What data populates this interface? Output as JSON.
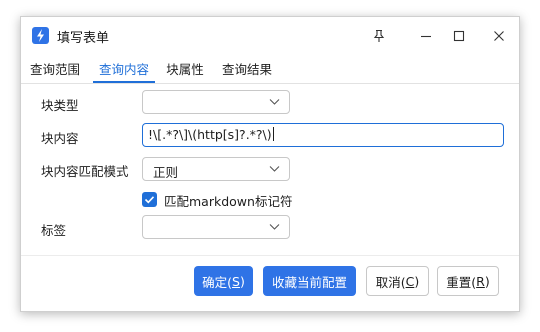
{
  "window": {
    "title": "填写表单"
  },
  "tabs": [
    {
      "label": "查询范围",
      "active": false
    },
    {
      "label": "查询内容",
      "active": true
    },
    {
      "label": "块属性",
      "active": false
    },
    {
      "label": "查询结果",
      "active": false
    }
  ],
  "form": {
    "block_type": {
      "label": "块类型",
      "value": ""
    },
    "block_content": {
      "label": "块内容",
      "value": "!\\[.*?\\]\\(http[s]?.*?\\)"
    },
    "match_mode": {
      "label": "块内容匹配模式",
      "value": "正则"
    },
    "markdown_checkbox": {
      "label": "匹配markdown标记符",
      "checked": true
    },
    "tag": {
      "label": "标签",
      "value": ""
    }
  },
  "buttons": {
    "confirm": {
      "text": "确定(",
      "key": "S",
      "tail": ")"
    },
    "save_config": {
      "text": "收藏当前配置"
    },
    "cancel": {
      "text": "取消(",
      "key": "C",
      "tail": ")"
    },
    "reset": {
      "text": "重置(",
      "key": "R",
      "tail": ")"
    }
  },
  "colors": {
    "accent": "#1f6fd8",
    "primary_button": "#2f73e6"
  }
}
